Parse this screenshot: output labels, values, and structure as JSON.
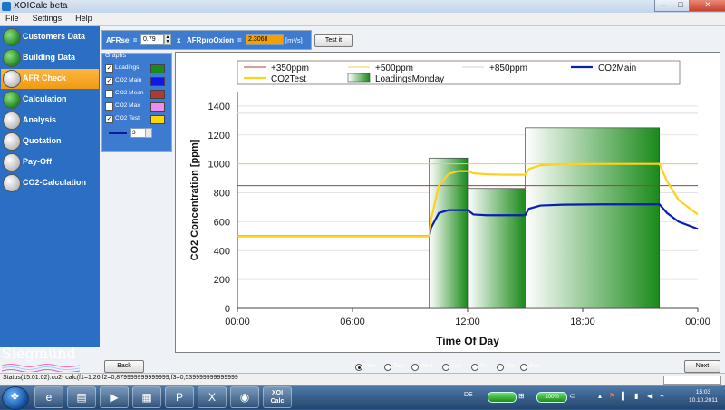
{
  "window": {
    "title": "XOICalc beta"
  },
  "menu": [
    "File",
    "Settings",
    "Help"
  ],
  "sidebar": {
    "items": [
      {
        "label": "Customers Data",
        "state": "green"
      },
      {
        "label": "Building Data",
        "state": "green"
      },
      {
        "label": "AFR Check",
        "state": "active"
      },
      {
        "label": "Calculation",
        "state": "green"
      },
      {
        "label": "Analysis",
        "state": "grey"
      },
      {
        "label": "Quotation",
        "state": "grey"
      },
      {
        "label": "Pay-Off",
        "state": "grey"
      },
      {
        "label": "CO2-Calculation",
        "state": "grey"
      }
    ],
    "logo": "Siegmund"
  },
  "afr": {
    "sel_label": "AFRsel =",
    "sel_value": "0.79",
    "times": "x",
    "prooxion_label": "AFRproOxion",
    "equals": "=",
    "result_value": "2.3068",
    "unit": "[m³/s]",
    "test_button": "Test it"
  },
  "graphs": {
    "title": "Graphs",
    "items": [
      {
        "label": "Loadings",
        "checked": true,
        "color": "#1a8a1a"
      },
      {
        "label": "CO2 Main",
        "checked": true,
        "color": "#1515e8"
      },
      {
        "label": "CO2 Mean",
        "checked": false,
        "color": "#b0383b"
      },
      {
        "label": "CO2 Max",
        "checked": false,
        "color": "#f08cf0"
      },
      {
        "label": "CO2 Test",
        "checked": true,
        "color": "#ffd700"
      }
    ],
    "line_width": "3"
  },
  "chart_data": {
    "type": "line",
    "ylabel": "CO2 Concentration [ppm]",
    "xlabel": "Time Of Day",
    "ylim": [
      0,
      1500
    ],
    "yticks": [
      "0",
      "200",
      "400",
      "600",
      "800",
      "1000",
      "1200",
      "1400"
    ],
    "xticks": [
      "00:00",
      "06:00",
      "12:00",
      "18:00",
      "00:00"
    ],
    "grid": "horizontal",
    "legend": {
      "placement": "top",
      "entries": [
        "+350ppm",
        "+500ppm",
        "+850ppm",
        "CO2Main",
        "CO2Test",
        "LoadingsMonday"
      ]
    },
    "reference_lines": [
      {
        "name": "+350ppm",
        "y": 850,
        "color": "#b0383b"
      },
      {
        "name": "+500ppm",
        "y": 1000,
        "color": "#ead05c"
      },
      {
        "name": "+850ppm",
        "y": 1350,
        "color": "#dcdcdc"
      }
    ],
    "bars": {
      "name": "LoadingsMonday",
      "color": "#1a8a1a",
      "items": [
        {
          "start": 10.0,
          "end": 12.0,
          "value": 1040
        },
        {
          "start": 12.0,
          "end": 15.0,
          "value": 830
        },
        {
          "start": 15.0,
          "end": 22.0,
          "value": 1250
        }
      ]
    },
    "series": [
      {
        "name": "CO2Main",
        "color": "#0a1fb0",
        "x": [
          0,
          10,
          10.1,
          10.5,
          11,
          11.5,
          12,
          12.3,
          13,
          14,
          15,
          15.2,
          15.8,
          17,
          19,
          21,
          22,
          22.4,
          23,
          24
        ],
        "y": [
          500,
          500,
          560,
          660,
          680,
          680,
          680,
          650,
          645,
          645,
          645,
          690,
          712,
          718,
          720,
          720,
          720,
          660,
          600,
          550
        ]
      },
      {
        "name": "CO2Test",
        "color": "#ffd21a",
        "x": [
          0,
          10,
          10.1,
          10.5,
          11,
          11.5,
          12,
          12.3,
          13,
          14,
          15,
          15.2,
          15.8,
          17,
          19,
          21,
          22,
          22.4,
          23,
          24
        ],
        "y": [
          500,
          500,
          620,
          850,
          930,
          950,
          950,
          935,
          928,
          925,
          925,
          965,
          990,
          998,
          1000,
          1000,
          1000,
          880,
          750,
          650
        ]
      }
    ]
  },
  "days": {
    "items": [
      "Mon",
      "Tue",
      "Wed",
      "Thu",
      "Fri",
      "Sat",
      "Sun"
    ],
    "selected": "Mon"
  },
  "nav": {
    "back": "Back",
    "next": "Next"
  },
  "status": {
    "text": "Status(15:01:02):co2- calc(f1=1,26;f2=0,879999999999999;f3=0,539999999999999"
  },
  "taskbar": {
    "xoi_label": "XOI\nCalc",
    "lang": "DE",
    "battery": "100%",
    "time": "15:03",
    "date": "10.10.2011"
  }
}
